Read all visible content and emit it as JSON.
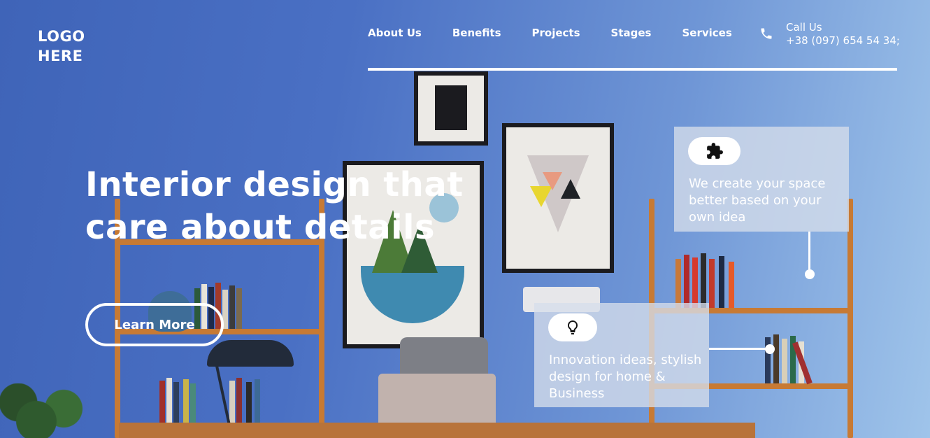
{
  "header": {
    "logo_line1": "LOGO",
    "logo_line2": "HERE",
    "nav": [
      {
        "label": "About Us"
      },
      {
        "label": "Benefits"
      },
      {
        "label": "Projects"
      },
      {
        "label": "Stages"
      },
      {
        "label": "Services"
      }
    ],
    "call_label": "Call Us",
    "phone": "+38 (097) 654 54 34;",
    "phone_icon": "phone-icon"
  },
  "hero": {
    "title": "Interior design that care about details",
    "button_label": "Learn More"
  },
  "cards": [
    {
      "icon": "puzzle-icon",
      "text": "We create your space better based on your own idea"
    },
    {
      "icon": "lightbulb-icon",
      "text": "Innovation ideas, stylish design for home & Business"
    }
  ],
  "colors": {
    "background_blue": "#4a70c4",
    "wood": "#c77a34",
    "text": "#ffffff"
  }
}
